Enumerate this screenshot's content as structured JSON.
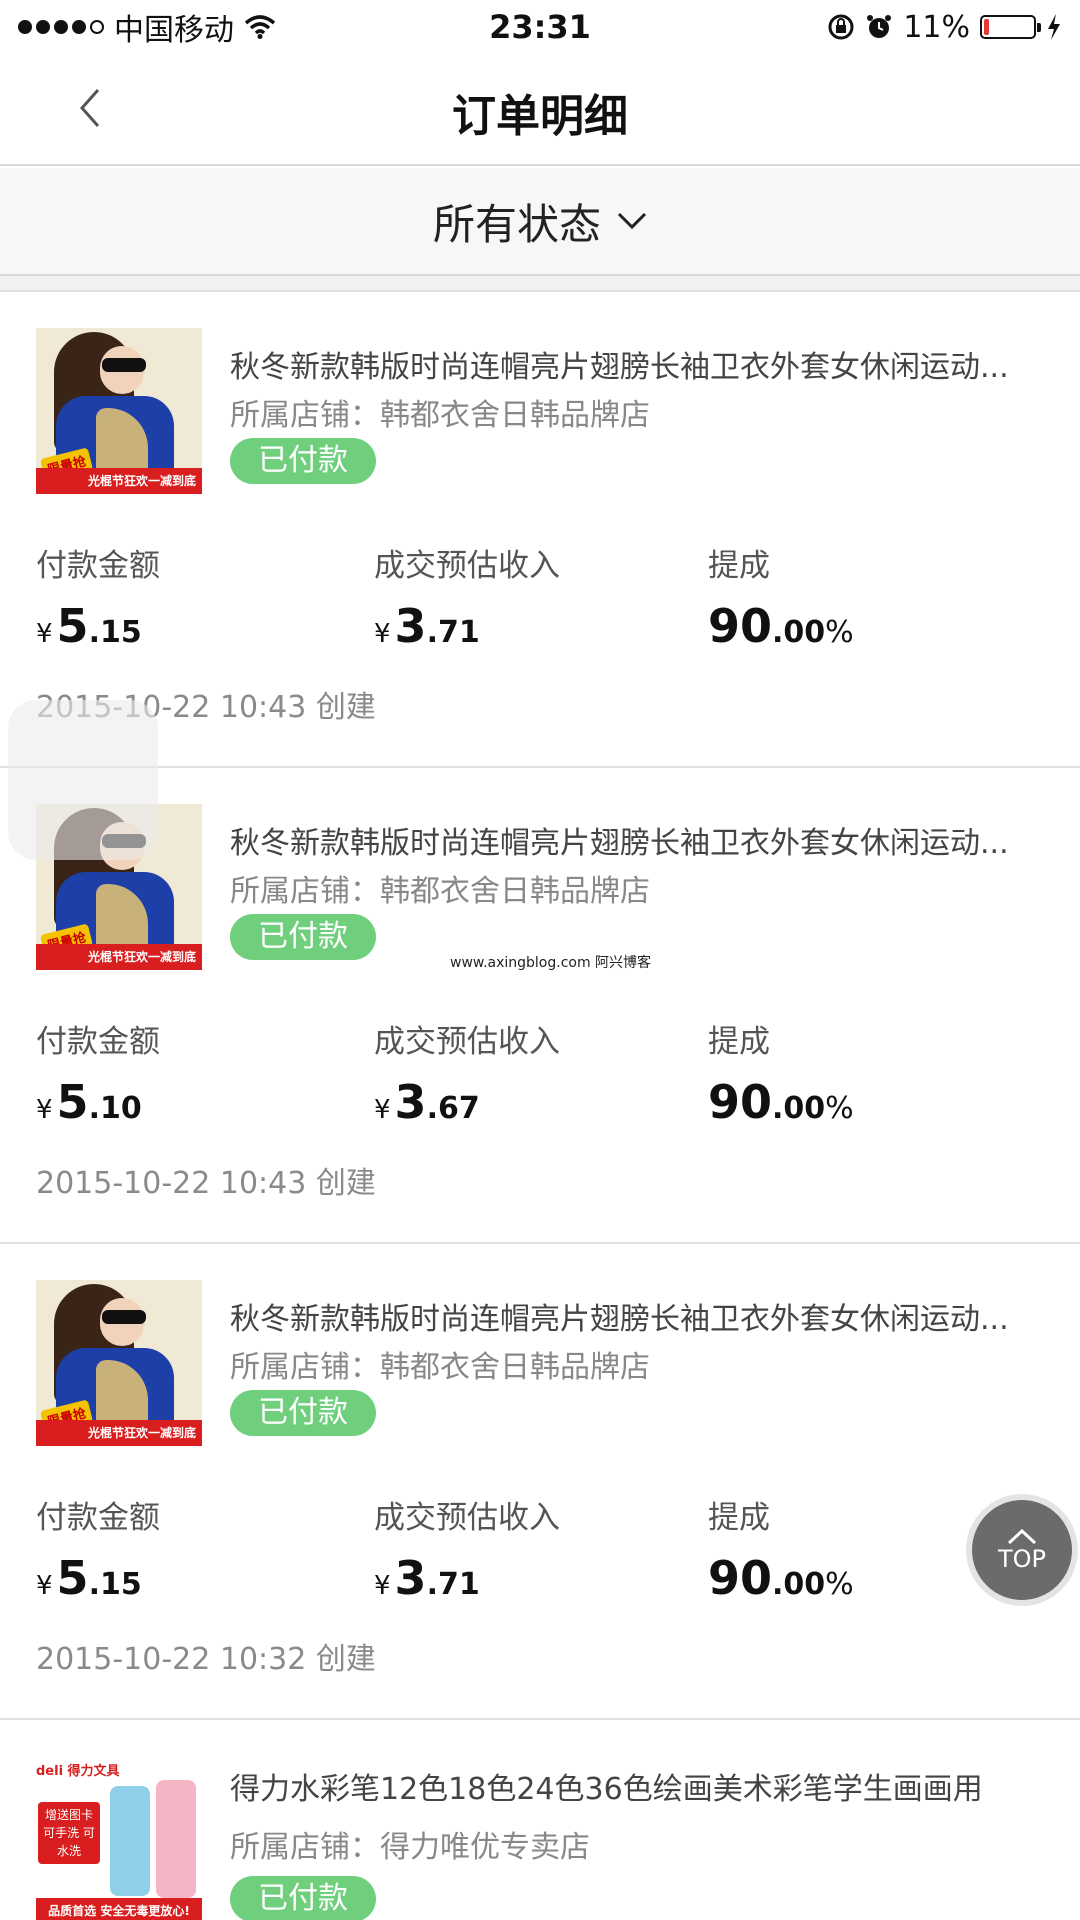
{
  "status_bar": {
    "carrier": "中国移动",
    "time": "23:31",
    "battery_text": "11%",
    "battery_level": 0.11,
    "signal_dots_filled": 4,
    "signal_dots_total": 5
  },
  "nav": {
    "title": "订单明细"
  },
  "filter": {
    "label": "所有状态"
  },
  "labels": {
    "pay_amount": "付款金额",
    "est_income": "成交预估收入",
    "commission": "提成",
    "currency": "¥",
    "percent": "%"
  },
  "orders": [
    {
      "title": "秋冬新款韩版时尚连帽亮片翅膀长袖卫衣外套女休闲运动...",
      "shop": "所属店铺：韩都衣舍日韩品牌店",
      "status": "已付款",
      "pay_big": "5",
      "pay_small": ".15",
      "income_big": "3",
      "income_small": ".71",
      "commission_big": "90",
      "commission_small": ".00",
      "created": "2015-10-22 10:43 创建",
      "thumb": {
        "tag": "限量抢",
        "banner": "光棍节狂欢一减到底"
      }
    },
    {
      "title": "秋冬新款韩版时尚连帽亮片翅膀长袖卫衣外套女休闲运动...",
      "shop": "所属店铺：韩都衣舍日韩品牌店",
      "status": "已付款",
      "pay_big": "5",
      "pay_small": ".10",
      "income_big": "3",
      "income_small": ".67",
      "commission_big": "90",
      "commission_small": ".00",
      "created": "2015-10-22 10:43 创建",
      "thumb": {
        "tag": "限量抢",
        "banner": "光棍节狂欢一减到底"
      }
    },
    {
      "title": "秋冬新款韩版时尚连帽亮片翅膀长袖卫衣外套女休闲运动...",
      "shop": "所属店铺：韩都衣舍日韩品牌店",
      "status": "已付款",
      "pay_big": "5",
      "pay_small": ".15",
      "income_big": "3",
      "income_small": ".71",
      "commission_big": "90",
      "commission_small": ".00",
      "created": "2015-10-22 10:32 创建",
      "thumb": {
        "tag": "限量抢",
        "banner": "光棍节狂欢一减到底"
      }
    },
    {
      "title": "得力水彩笔12色18色24色36色绘画美术彩笔学生画画用",
      "shop": "所属店铺：得力唯优专卖店",
      "status": "已付款",
      "thumb": {
        "brand": "deli 得力文具",
        "promo": "增送图卡 可手洗 可水洗",
        "banner": "品质首选 安全无毒更放心!"
      }
    }
  ],
  "watermark": "www.axingblog.com 阿兴博客",
  "top_button": {
    "label": "TOP"
  },
  "colors": {
    "status_badge": "#6fcf7d",
    "banner_red": "#d81e1e",
    "battery_low": "#e53935",
    "top_button": "#6b6b6b"
  }
}
